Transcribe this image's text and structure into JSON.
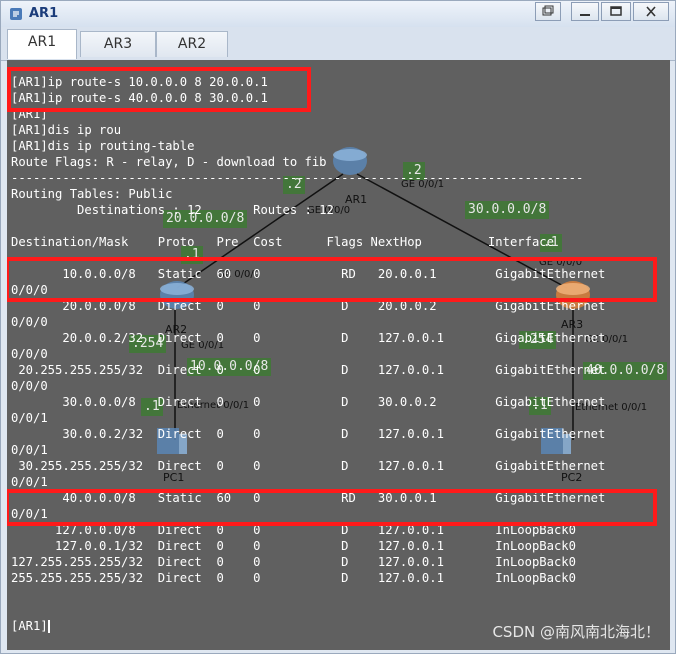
{
  "window": {
    "title": "AR1"
  },
  "tabs": [
    {
      "label": "AR1",
      "active": true
    },
    {
      "label": "AR3",
      "active": false
    },
    {
      "label": "AR2",
      "active": false
    }
  ],
  "terminal": {
    "lines": [
      "[AR1]ip route-s 10.0.0.0 8 20.0.0.1",
      "[AR1]ip route-s 40.0.0.0 8 30.0.0.1",
      "[AR1]",
      "[AR1]dis ip rou",
      "[AR1]dis ip routing-table",
      "Route Flags: R - relay, D - download to fib",
      "------------------------------------------------------------------------------",
      "Routing Tables: Public",
      "         Destinations : 12       Routes : 12",
      "",
      "Destination/Mask    Proto   Pre  Cost      Flags NextHop         Interface",
      "",
      "       10.0.0.0/8   Static  60   0           RD   20.0.0.1        GigabitEthernet",
      "0/0/0",
      "       20.0.0.0/8   Direct  0    0           D    20.0.0.2        GigabitEthernet",
      "0/0/0",
      "       20.0.0.2/32  Direct  0    0           D    127.0.0.1       GigabitEthernet",
      "0/0/0",
      " 20.255.255.255/32  Direct  0    0           D    127.0.0.1       GigabitEthernet",
      "0/0/0",
      "       30.0.0.0/8   Direct  0    0           D    30.0.0.2        GigabitEthernet",
      "0/0/1",
      "       30.0.0.2/32  Direct  0    0           D    127.0.0.1       GigabitEthernet",
      "0/0/1",
      " 30.255.255.255/32  Direct  0    0           D    127.0.0.1       GigabitEthernet",
      "0/0/1",
      "       40.0.0.0/8   Static  60   0           RD   30.0.0.1        GigabitEthernet",
      "0/0/1",
      "      127.0.0.0/8   Direct  0    0           D    127.0.0.1       InLoopBack0",
      "      127.0.0.1/32  Direct  0    0           D    127.0.0.1       InLoopBack0",
      "127.255.255.255/32  Direct  0    0           D    127.0.0.1       InLoopBack0",
      "255.255.255.255/32  Direct  0    0           D    127.0.0.1       InLoopBack0",
      "",
      "",
      "[AR1]"
    ]
  },
  "topology": {
    "devices": {
      "ar1": "AR1",
      "ar2": "AR2",
      "ar3": "AR3",
      "pc1": "PC1",
      "pc2": "PC2"
    },
    "subnet_labels": {
      "net20": "20.0.0.0/8",
      "net30": "30.0.0.0/8",
      "net10": "10.0.0.0/8",
      "net40": "40.0.0.0/8",
      "ip_ar1_left": ".2",
      "ip_ar1_right": ".2",
      "ip_ar2_top": ".1",
      "ip_ar2_left": ".254",
      "ip_pc1": ".1",
      "ip_ar3_top": ".1",
      "ip_ar3_left": ".254",
      "ip_pc2": ".1"
    },
    "ports": {
      "ar1_g000": "GE 0/0/0",
      "ar1_g001": "GE 0/0/1",
      "ar2_g000": "GE 0/0/0",
      "ar2_g001": "GE 0/0/1",
      "pc1_eth": "Ethernet 0/0/1",
      "ar3_g000": "GE 0/0/0",
      "ar3_g001": "GE 0/0/1",
      "pc2_eth": "Ethernet 0/0/1"
    }
  },
  "watermark": "CSDN @南风南北海北！",
  "colors": {
    "terminal_bg": "#606060",
    "highlight": "#ff1a1a",
    "label_bg": "#3e7a34"
  }
}
